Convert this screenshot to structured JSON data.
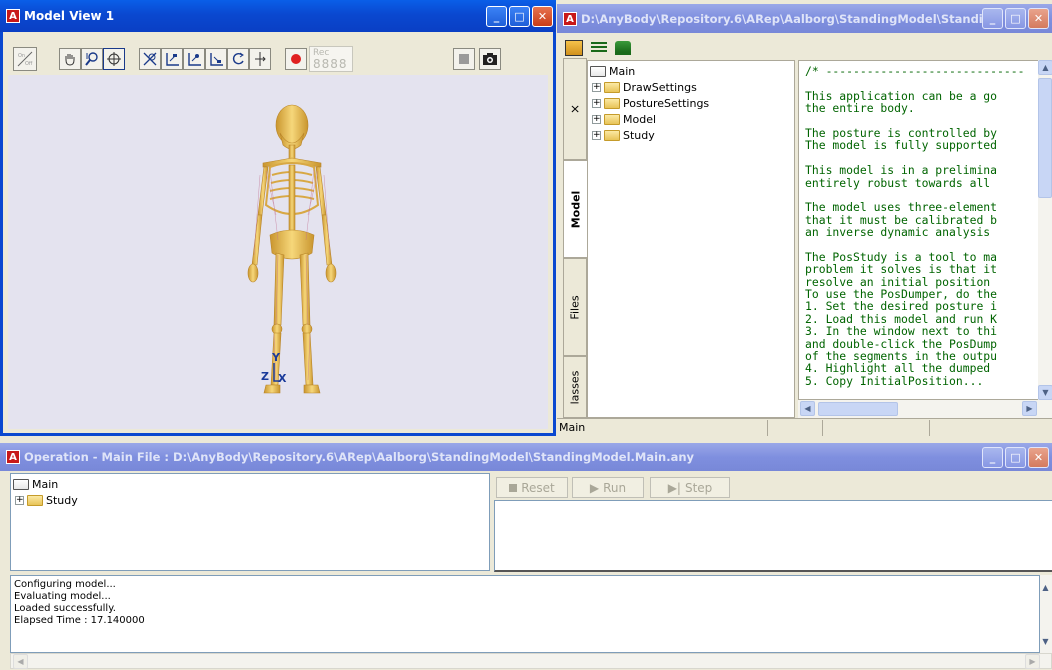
{
  "model_view": {
    "title": "Model View 1",
    "rec_label": "Rec",
    "rec_digits": "8888",
    "axis_labels": {
      "z": "Z",
      "y": "Y",
      "x": "X"
    }
  },
  "model_tree_window": {
    "title": "D:\\AnyBody\\Repository.6\\ARep\\Aalborg\\StandingModel\\Standi...",
    "tree_items": [
      "Main",
      "DrawSettings",
      "PostureSettings",
      "Model",
      "Study"
    ],
    "tabs": [
      "Model",
      "Files",
      "lasses"
    ],
    "status": "Main",
    "code_lines": [
      "/* -----------------------------",
      "",
      "This application can be a go",
      "the entire body.",
      "",
      "The posture is controlled by",
      "The model is fully supported",
      "",
      "This model is in a prelimina",
      "entirely robust towards all ",
      "",
      "The model uses three-element",
      "that it must be calibrated b",
      "an inverse dynamic analysis ",
      "",
      "The PosStudy is a tool to ma",
      "problem it solves is that it",
      "resolve an initial position ",
      "To use the PosDumper, do the",
      "1. Set the desired posture i",
      "2. Load this model and run K",
      "3. In the window next to thi",
      "and double-click the PosDump",
      "of the segments in the outpu",
      "4. Highlight all the dumped ",
      "5. Copy InitialPosition..."
    ]
  },
  "operation_window": {
    "title": "Operation - Main File : D:\\AnyBody\\Repository.6\\ARep\\Aalborg\\StandingModel\\StandingModel.Main.any",
    "tree_items": [
      "Main",
      "Study"
    ],
    "buttons": {
      "reset": "Reset",
      "run": "Run",
      "step": "Step"
    },
    "output_lines": [
      "Configuring model...",
      "Evaluating model...",
      "Loaded successfully.",
      "Elapsed Time : 17.140000"
    ]
  },
  "colors": {
    "titlebar_active": "#0a48d0",
    "bone": "#e8c060",
    "record": "#e02020",
    "code_text": "#006400"
  }
}
